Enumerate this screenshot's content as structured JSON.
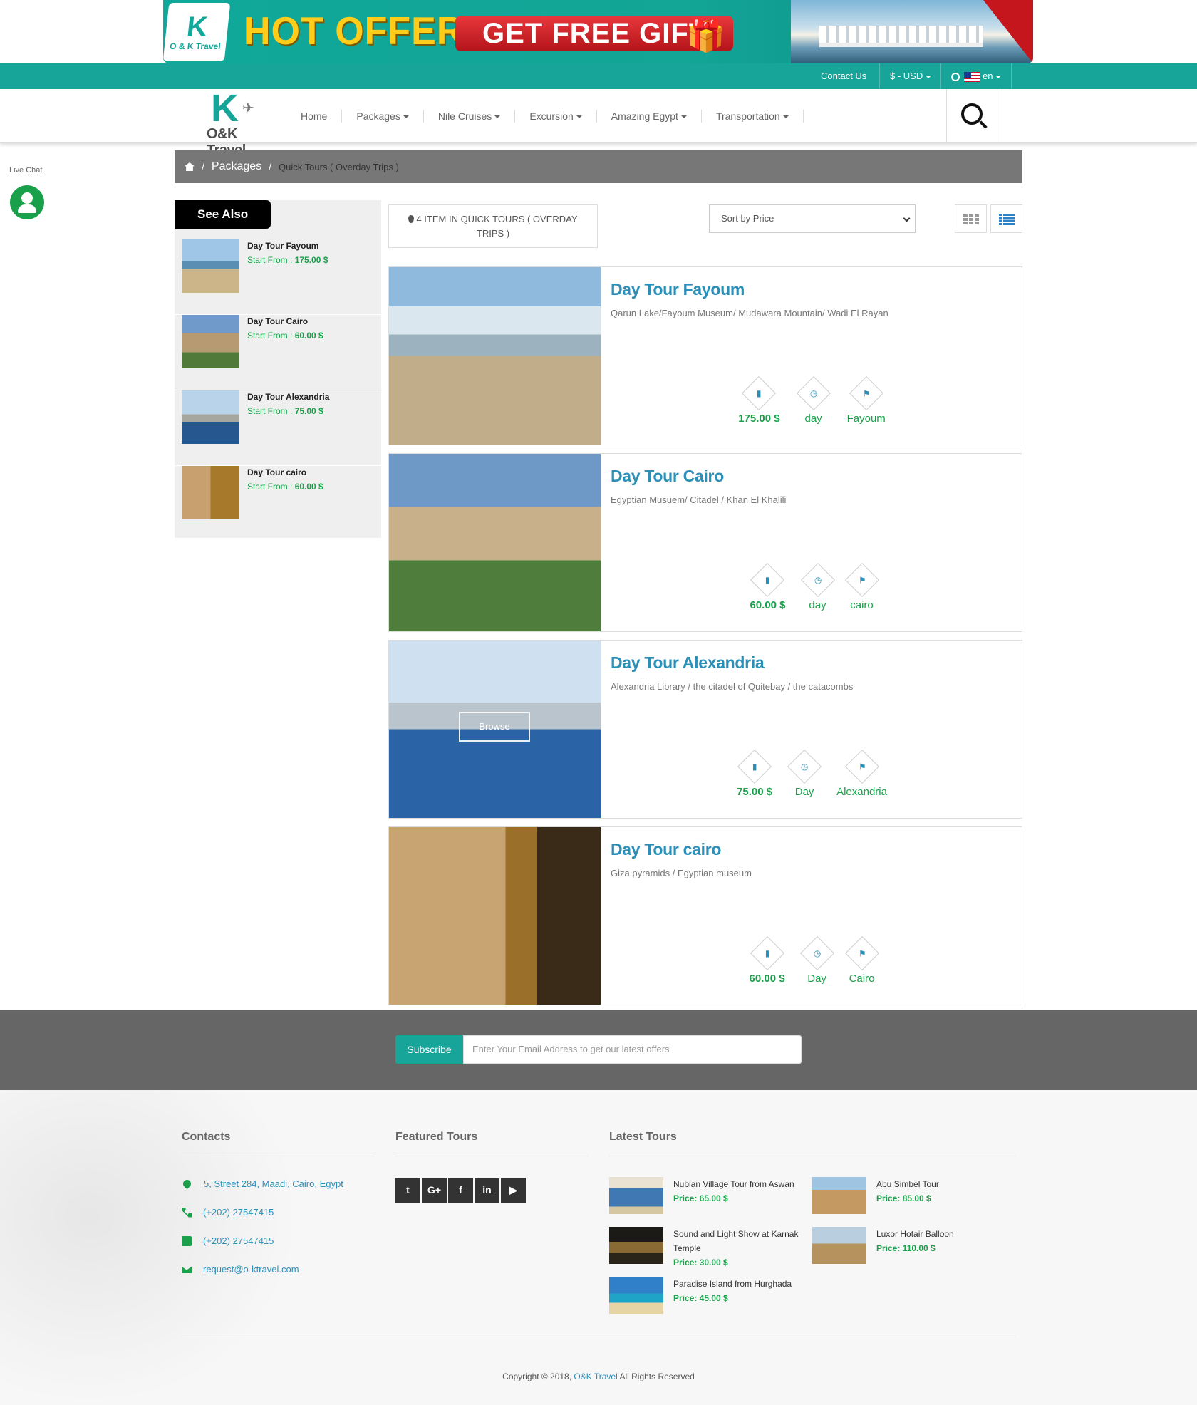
{
  "promo": {
    "logo_letter": "K",
    "logo_text": "O & K Travel",
    "hot_offer": "HOT OFFER",
    "gift": "GET FREE GIFT"
  },
  "topbar": {
    "contact": "Contact Us",
    "currency": "$ - USD",
    "language": "en"
  },
  "nav": {
    "logo_letter": "K",
    "logo_text": "O&K Travel",
    "items": [
      "Home",
      "Packages",
      "Nile Cruises",
      "Excursion",
      "Amazing Egypt",
      "Transportation"
    ]
  },
  "live_chat": {
    "label": "Live Chat"
  },
  "breadcrumb": {
    "packages": "Packages",
    "current": "Quick Tours ( Overday Trips )"
  },
  "sidebar": {
    "title": "See Also",
    "price_prefix": "Start From :",
    "items": [
      {
        "name": "Day Tour Fayoum",
        "price": "175.00 $"
      },
      {
        "name": "Day Tour Cairo",
        "price": "60.00 $"
      },
      {
        "name": "Day Tour Alexandria",
        "price": "75.00 $"
      },
      {
        "name": "Day Tour cairo",
        "price": "60.00 $"
      }
    ]
  },
  "toolbar": {
    "count_text": "4 ITEM IN QUICK TOURS ( OVERDAY TRIPS )",
    "sort_label": "Sort by Price"
  },
  "tours": [
    {
      "title": "Day Tour Fayoum",
      "desc": "Qarun Lake/Fayoum Museum/ Mudawara Mountain/ Wadi El Rayan",
      "price": "175.00 $",
      "duration": "day",
      "location": "Fayoum"
    },
    {
      "title": "Day Tour Cairo",
      "desc": "Egyptian Musuem/ Citadel / Khan El Khalili",
      "price": "60.00 $",
      "duration": "day",
      "location": "cairo"
    },
    {
      "title": "Day Tour Alexandria",
      "desc": "Alexandria Library / the citadel of Quitebay / the catacombs",
      "price": "75.00 $",
      "duration": "Day",
      "location": "Alexandria",
      "browse": "Browse"
    },
    {
      "title": "Day Tour cairo",
      "desc": "Giza pyramids / Egyptian museum",
      "price": "60.00 $",
      "duration": "Day",
      "location": "Cairo"
    }
  ],
  "subscribe": {
    "button": "Subscribe",
    "placeholder": "Enter Your Email Address to get our latest offers"
  },
  "footer": {
    "contacts_title": "Contacts",
    "featured_title": "Featured Tours",
    "latest_title": "Latest Tours",
    "address": "5, Street 284, Maadi, Cairo, Egypt",
    "phone": "(+202) 27547415",
    "fax": "(+202) 27547415",
    "email": "request@o-ktravel.com",
    "socials": [
      "twitter-icon",
      "google-plus-icon",
      "facebook-icon",
      "linkedin-icon",
      "youtube-icon"
    ],
    "latest": [
      {
        "name": "Nubian Village Tour from Aswan",
        "price": "Price: 65.00 $"
      },
      {
        "name": "Abu Simbel Tour",
        "price": "Price: 85.00 $"
      },
      {
        "name": "Sound and Light Show at Karnak Temple",
        "price": "Price: 30.00 $"
      },
      {
        "name": "Luxor Hotair Balloon",
        "price": "Price: 110.00 $"
      },
      {
        "name": "Paradise Island from Hurghada",
        "price": "Price: 45.00 $"
      }
    ],
    "copyright_prefix": "Copyright © 2018,",
    "copyright_brand": "O&K Travel",
    "copyright_suffix": "All Rights Reserved"
  },
  "colors": {
    "teal": "#17a59a",
    "green": "#1aa04a",
    "blue_title": "#2b8fb8"
  }
}
